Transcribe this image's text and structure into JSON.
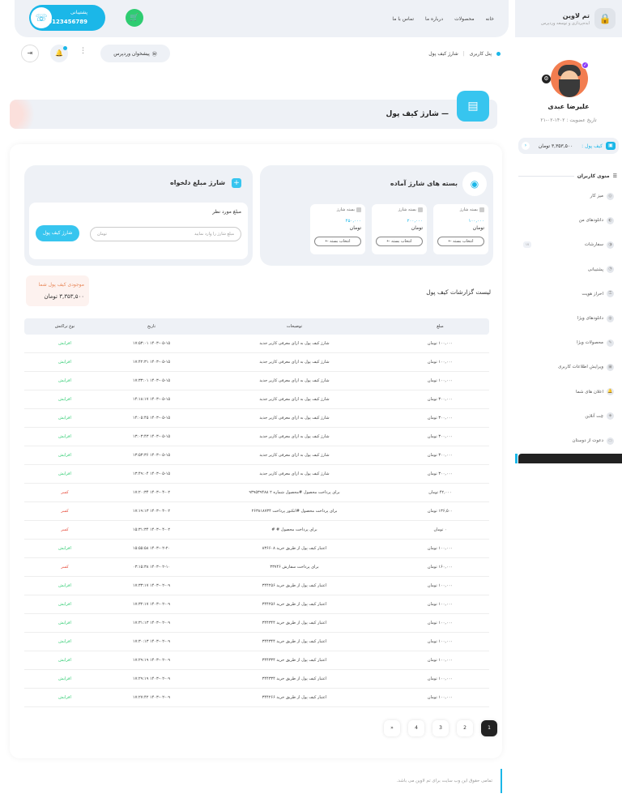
{
  "brand": {
    "name": "تم لاوین",
    "tagline": "ایده‌پردازی و توسعه وردپرس"
  },
  "nav": [
    "خانه",
    "محصولات",
    "درباره ما",
    "تماس با ما"
  ],
  "support": {
    "label": "پشتیبانی",
    "phone": "09123456789"
  },
  "breadcrumb": [
    "پنل کاربری",
    "شارژ کیف پول"
  ],
  "wp_button": "پیشخوان وردپرس",
  "page_title": "— شارژ کیف پول",
  "user": {
    "name": "علیرضا عبدی",
    "joined": "تاریخ عضویت : ۱۴۰۲-۰۲-۲۱"
  },
  "wallet": {
    "label": "کیف پول :",
    "amount": "۳,۳۵۳,۵۰۰ تومان"
  },
  "menu_title": "منوی کاربران",
  "menu": [
    {
      "label": "میز کار"
    },
    {
      "label": "دانلودهای من"
    },
    {
      "label": "سفارشات",
      "badge": "۱۷"
    },
    {
      "label": "پشتیبانی"
    },
    {
      "label": "احراز هویت"
    },
    {
      "label": "دانلودهای ویژا"
    },
    {
      "label": "محصولات ویژا"
    },
    {
      "label": "ویرایش اطلاعات کاربری"
    },
    {
      "label": "اعلان های شما"
    },
    {
      "label": "چت آنلاین"
    },
    {
      "label": "دعوت از دوستان"
    }
  ],
  "packages": {
    "title": "بسته های شارژ آماده",
    "items": [
      {
        "name": "بسته شارژ",
        "amount": "۱۰۰,۰۰۰",
        "unit": "تومان",
        "button": "انتخاب بسته ←"
      },
      {
        "name": "بسته شارژ",
        "amount": "۲۰۰,۰۰۰",
        "unit": "تومان",
        "button": "انتخاب بسته ←"
      },
      {
        "name": "بسته شارژ",
        "amount": "۴۵۰,۰۰۰",
        "unit": "تومان",
        "button": "انتخاب بسته ←"
      }
    ]
  },
  "custom": {
    "title": "شارژ مبلغ دلخواه",
    "label": "مبلغ مورد نظر",
    "placeholder": "مبلغ شارژ را وارد نمایید",
    "unit": "تومان",
    "button": "شارژ کیف پول"
  },
  "balance": {
    "label": "موجودی کیف پول شما",
    "amount": "۳,۳۵۳,۵۰۰ تومان"
  },
  "list_title": "لیست گزارشات کیف پول",
  "table": {
    "headers": [
      "مبلغ",
      "توضیحات",
      "تاریخ",
      "نوع تراکنش"
    ],
    "rows": [
      [
        "۱۰۰,۰۰۰ تومان",
        "شارژ کیف پول به ازای معرفی کاربر جدید",
        "۱۴۰۳-۰۵-۱۵ ۱۷:۵۳:۰۱",
        "افزایش"
      ],
      [
        "۱۰۰,۰۰۰ تومان",
        "شارژ کیف پول به ازای معرفی کاربر جدید",
        "۱۴۰۳-۰۵-۱۵ ۱۷:۴۲:۳۱",
        "افزایش"
      ],
      [
        "۱۰۰,۰۰۰ تومان",
        "شارژ کیف پول به ازای معرفی کاربر جدید",
        "۱۴۰۳-۰۵-۱۵ ۱۷:۳۳:۰۱",
        "افزایش"
      ],
      [
        "۳۰۰,۰۰۰ تومان",
        "شارژ کیف پول به ازای معرفی کاربر جدید",
        "۱۴۰۳-۰۵-۱۵ ۱۴:۱۸:۱۷",
        "افزایش"
      ],
      [
        "۳۰۰,۰۰۰ تومان",
        "شارژ کیف پول به ازای معرفی کاربر جدید",
        "۱۴۰۳-۰۵-۱۵ ۱۴:۰۵:۴۵",
        "افزایش"
      ],
      [
        "۳۰۰,۰۰۰ تومان",
        "شارژ کیف پول به ازای معرفی کاربر جدید",
        "۱۴۰۳-۰۵-۱۵ ۱۳:۰۳:۴۳",
        "افزایش"
      ],
      [
        "۳۰۰,۰۰۰ تومان",
        "شارژ کیف پول به ازای معرفی کاربر جدید",
        "۱۴۰۳-۰۵-۱۵ ۱۳:۵۳:۳۶",
        "افزایش"
      ],
      [
        "۳۰۰,۰۰۰ تومان",
        "شارژ کیف پول به ازای معرفی کاربر جدید",
        "۱۴۰۳-۰۵-۱۵ ۱۳:۴۹:۰۴",
        "افزایش"
      ],
      [
        "۴۲,۰۰۰ تومان",
        "برای پرداخت محصول #محصول شماره ۲ ۹۳۹۵۳۹۴۸۸",
        "۱۴۰۳-۰۴-۰۲ ۱۷:۲۰:۳۴",
        "کسر"
      ],
      [
        "۱۳۶,۵۰۰ تومان",
        "برای پرداخت محصول #انکتور پرداخت ۲۶۳۸۱۸۷۳۴",
        "۱۴۰۳-۰۴-۰۲ ۱۷:۱۹:۱۳",
        "کسر"
      ],
      [
        "۰ تومان",
        "برای پرداخت محصول # #",
        "۱۴۰۳-۰۴-۰۲ ۱۵:۳۱:۳۴",
        "کسر"
      ],
      [
        "۱۰۰,۰۰۰ تومان",
        "اعتبار کیف پول از طریق خرید ۸۳۶۶۰۸",
        "۱۴۰۳-۰۲-۲۰ ۱۵:۵۵:۵۸",
        "افزایش"
      ],
      [
        "۱۶۰,۰۰۰ تومان",
        "برای پرداخت سفارش ۳۳۷۴۶",
        "۱۴۰۳-۰۲-۱۰ ۰۳:۱۵:۳۸",
        "کسر"
      ],
      [
        "۱۰۰,۰۰۰ تومان",
        "اعتبار کیف پول از طریق خرید ۳۴۴۲۵۶",
        "۱۴۰۳-۰۲-۰۹ ۱۷:۳۳:۱۷",
        "افزایش"
      ],
      [
        "۱۰۰,۰۰۰ تومان",
        "اعتبار کیف پول از طریق خرید ۳۴۴۲۵۶",
        "۱۴۰۳-۰۲-۰۹ ۱۷:۳۲:۱۷",
        "افزایش"
      ],
      [
        "۱۰۰,۰۰۰ تومان",
        "اعتبار کیف پول از طریق خرید ۳۴۴۳۴۴",
        "۱۴۰۳-۰۲-۰۹ ۱۷:۳۱:۱۳",
        "افزایش"
      ],
      [
        "۱۰۰,۰۰۰ تومان",
        "اعتبار کیف پول از طریق خرید ۳۴۴۳۴۴",
        "۱۴۰۳-۰۲-۰۹ ۱۷:۳۰:۱۳",
        "افزایش"
      ],
      [
        "۱۰۰,۰۰۰ تومان",
        "اعتبار کیف پول از طریق خرید ۳۴۴۳۳۴",
        "۱۴۰۳-۰۲-۰۹ ۱۷:۲۹:۱۹",
        "افزایش"
      ],
      [
        "۱۰۰,۰۰۰ تومان",
        "اعتبار کیف پول از طریق خرید ۳۴۴۳۳۴",
        "۱۴۰۳-۰۲-۰۹ ۱۷:۲۹:۱۹",
        "افزایش"
      ],
      [
        "۱۰۰,۰۰۰ تومان",
        "اعتبار کیف پول از طریق خرید ۳۴۴۲۶۶",
        "۱۴۰۳-۰۲-۰۹ ۱۷:۲۷:۴۲",
        "افزایش"
      ]
    ]
  },
  "pagination": [
    "1",
    "2",
    "3",
    "4",
    "»"
  ],
  "footer": "تمامی حقوق این وب سایت برای تم لاوین می باشد.",
  "colors": {
    "accent": "#1bb7e8",
    "success": "#2ecc71",
    "danger": "#e74c3c",
    "panel": "#eef1f6"
  }
}
